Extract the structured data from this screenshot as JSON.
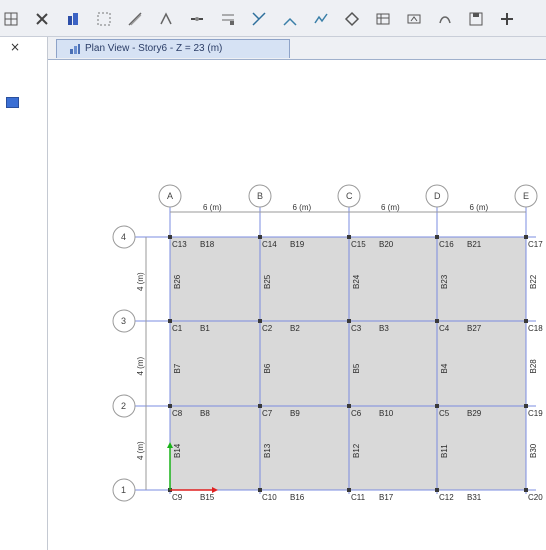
{
  "toolbar": {
    "icons": [
      "grid-icon",
      "close-icon",
      "building-icon",
      "select-icon",
      "draw-icon",
      "snap-icon",
      "beam-icon",
      "point-icon",
      "brace-icon",
      "wall-icon",
      "floor-icon",
      "assign-icon",
      "load-icon",
      "analysis-icon",
      "design-icon",
      "save-icon",
      "add-icon"
    ]
  },
  "left_panel": {
    "close_label": "×"
  },
  "tab": {
    "label": "Plan View - Story6 - Z = 23 (m)"
  },
  "plan": {
    "grid_x": [
      "A",
      "B",
      "C",
      "D",
      "E"
    ],
    "grid_y": [
      "4",
      "3",
      "2",
      "1"
    ],
    "x_spacings": [
      "6 (m)",
      "6 (m)",
      "6 (m)",
      "6 (m)"
    ],
    "y_spacings": [
      "4 (m)",
      "4 (m)",
      "4 (m)"
    ],
    "rows": [
      {
        "columns": [
          "C13",
          "C14",
          "C15",
          "C16",
          "C17"
        ],
        "beams": [
          "B18",
          "B19",
          "B20",
          "B21"
        ],
        "vbeams": [
          "B26",
          "B25",
          "B24",
          "B23",
          "B22"
        ]
      },
      {
        "columns": [
          "C1",
          "C2",
          "C3",
          "C4",
          "C18"
        ],
        "beams": [
          "B1",
          "B2",
          "B3",
          "B27"
        ],
        "vbeams": [
          "B7",
          "B6",
          "B5",
          "B4",
          "B28"
        ]
      },
      {
        "columns": [
          "C8",
          "C7",
          "C6",
          "C5",
          "C19"
        ],
        "beams": [
          "B8",
          "B9",
          "B10",
          "B29"
        ],
        "vbeams": [
          "B14",
          "B13",
          "B12",
          "B11",
          "B30"
        ]
      },
      {
        "columns": [
          "C9",
          "C10",
          "C11",
          "C12",
          "C20"
        ],
        "beams": [
          "B15",
          "B16",
          "B17",
          "B31"
        ],
        "vbeams": []
      }
    ],
    "colors": {
      "slab": "#d9d9d9",
      "grid_line": "#7b8ce0",
      "bubble": "#9a9a9a",
      "axis_x": "#e02020",
      "axis_y": "#19b219"
    }
  }
}
